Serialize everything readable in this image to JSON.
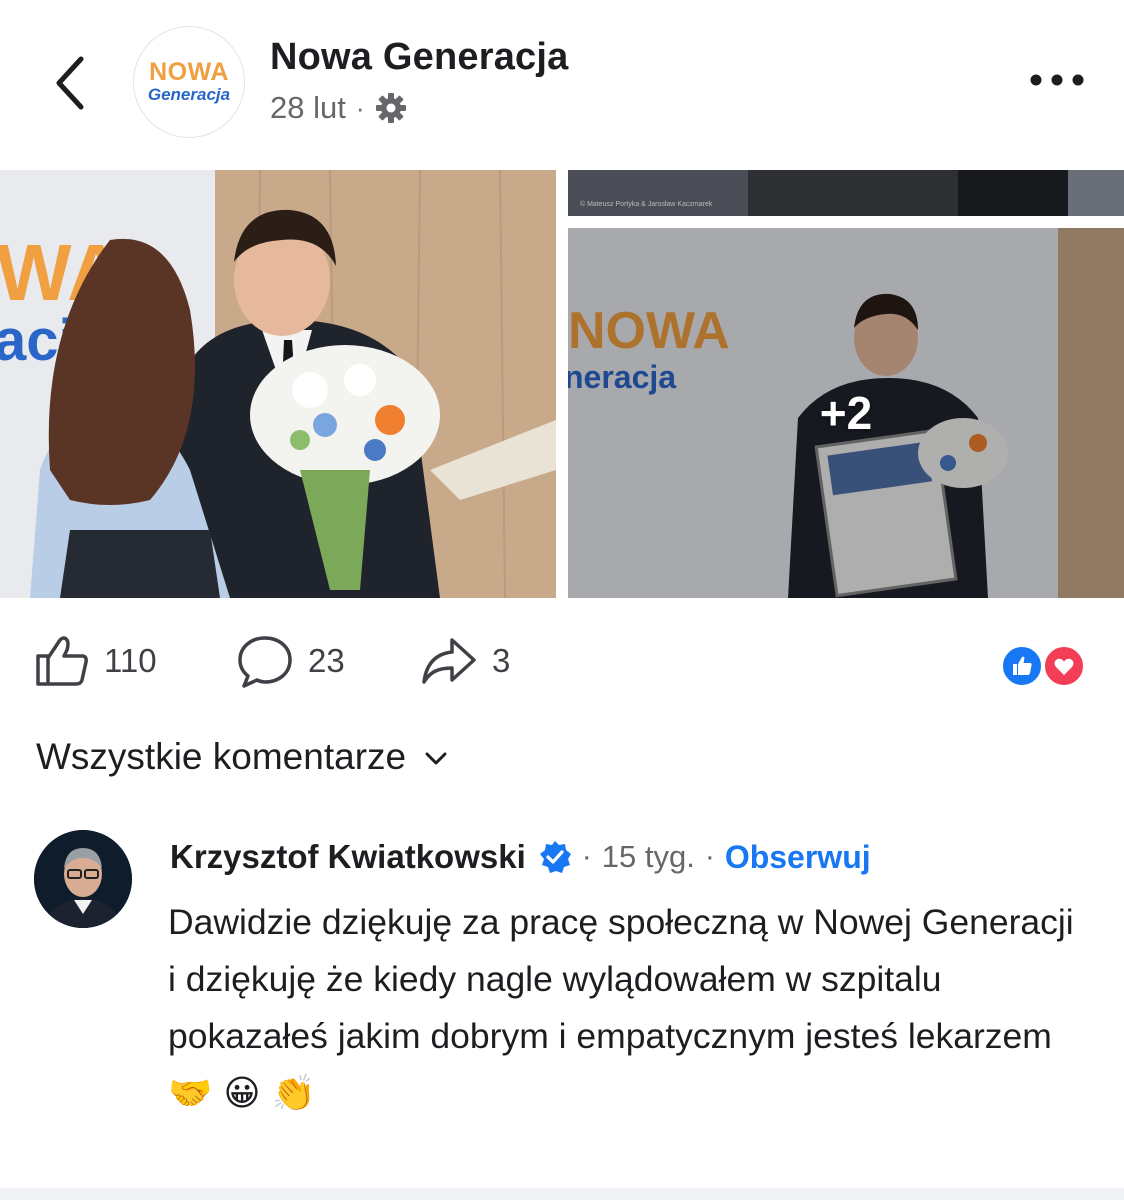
{
  "header": {
    "page_name": "Nowa Generacja",
    "date": "28 lut",
    "logo_line1": "NOWA",
    "logo_line2": "Generacja"
  },
  "photos": {
    "more_count": "+2",
    "backdrop_text_1": "WA",
    "backdrop_text_2": "aci",
    "backdrop_text_3": "NOWA",
    "backdrop_text_4": "neracja",
    "watermark": "© Mateusz Portyka & Jarosław Kaczmarek"
  },
  "actions": {
    "like_count": "110",
    "comment_count": "23",
    "share_count": "3"
  },
  "comments": {
    "filter_label": "Wszystkie komentarze",
    "items": [
      {
        "author": "Krzysztof Kwiatkowski",
        "time": "15 tyg.",
        "follow_label": "Obserwuj",
        "text": "Dawidzie dziękuję za pracę społeczną w Nowej Generacji i dziękuję że kiedy nagle wylądowałem w szpitalu pokazałeś jakim dobrym i empatycznym jesteś lekarzem",
        "emojis": "🤝 😀 👏"
      }
    ]
  },
  "colors": {
    "accent_blue": "#1877f2",
    "love_red": "#f33e58",
    "secondary_text": "#65676b",
    "brand_orange": "#f0a040",
    "brand_blue": "#2a66c8"
  }
}
